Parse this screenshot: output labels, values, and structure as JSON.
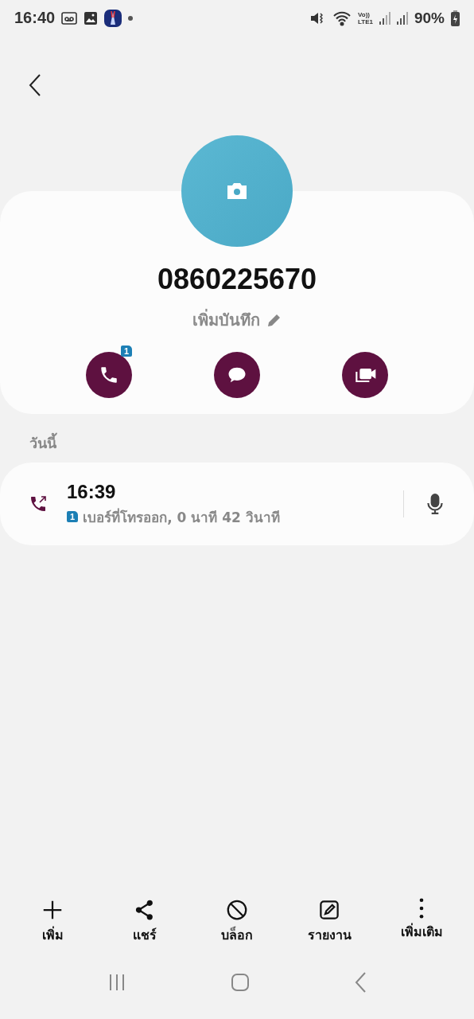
{
  "status_bar": {
    "time": "16:40",
    "volte": "Vo))",
    "lte": "LTE1",
    "battery": "90%"
  },
  "contact": {
    "name": "0860225670",
    "note_button": "เพิ่มบันทึก",
    "actions": [
      {
        "kind": "call",
        "badge": "1"
      },
      {
        "kind": "message"
      },
      {
        "kind": "video"
      }
    ]
  },
  "history": {
    "heading": "วันนี้",
    "calls": [
      {
        "kind": "outgoing",
        "time": "16:39",
        "sim": "1",
        "description": "เบอร์ที่โทรออก, 0 นาที 42 วินาที"
      }
    ]
  },
  "toolbar": [
    {
      "kind": "add",
      "label": "เพิ่ม"
    },
    {
      "kind": "share",
      "label": "แชร์"
    },
    {
      "kind": "block",
      "label": "บล็อก"
    },
    {
      "kind": "report",
      "label": "รายงาน"
    },
    {
      "kind": "more",
      "label": "เพิ่มเติม"
    }
  ]
}
